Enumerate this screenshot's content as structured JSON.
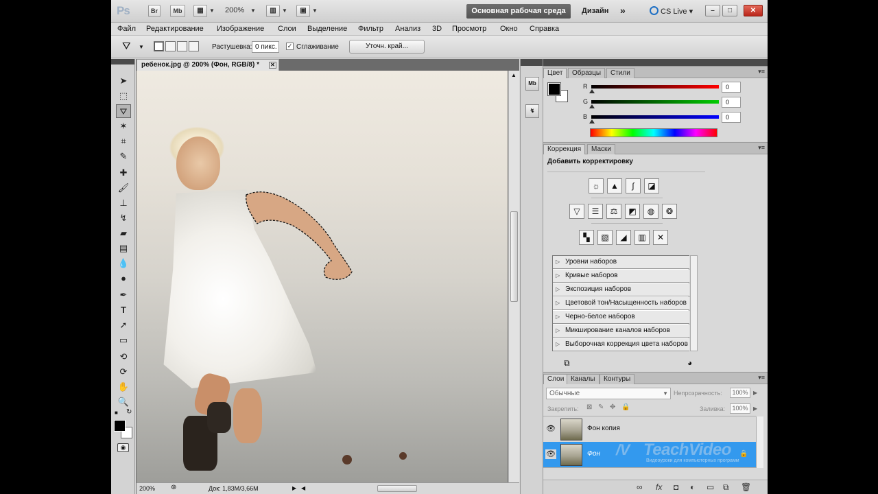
{
  "appbar": {
    "logo": "Ps",
    "br_label": "Br",
    "mb_label": "Mb",
    "zoom": "200%",
    "workspace": "Основная рабочая среда",
    "design": "Дизайн",
    "more": "»",
    "cslive": "CS Live"
  },
  "menu": [
    "Файл",
    "Редактирование",
    "Изображение",
    "Слои",
    "Выделение",
    "Фильтр",
    "Анализ",
    "3D",
    "Просмотр",
    "Окно",
    "Справка"
  ],
  "options": {
    "feather_label": "Растушевка:",
    "feather_value": "0 пикс.",
    "antialias_label": "Сглаживание",
    "antialias_checked": true,
    "refine_edge": "Уточн. край..."
  },
  "document": {
    "tab_title": "ребенок.jpg @ 200% (Фон, RGB/8) *",
    "status_zoom": "200%",
    "status_doc": "Док: 1,83М/3,66М"
  },
  "color_panel": {
    "tabs": [
      "Цвет",
      "Образцы",
      "Стили"
    ],
    "channels": [
      {
        "label": "R",
        "value": "0",
        "color": "#e00000"
      },
      {
        "label": "G",
        "value": "0",
        "color": "#00b000"
      },
      {
        "label": "B",
        "value": "0",
        "color": "#0000e0"
      }
    ]
  },
  "adjustments_panel": {
    "tabs": [
      "Коррекция",
      "Маски"
    ],
    "title": "Добавить корректировку",
    "presets": [
      "Уровни наборов",
      "Кривые наборов",
      "Экспозиция наборов",
      "Цветовой тон/Насыщенность наборов",
      "Черно-белое наборов",
      "Микширование каналов наборов",
      "Выборочная коррекция цвета наборов"
    ]
  },
  "layers_panel": {
    "tabs": [
      "Слои",
      "Каналы",
      "Контуры"
    ],
    "blend_mode": "Обычные",
    "opacity_label": "Непрозрачность:",
    "opacity": "100%",
    "lock_label": "Закрепить:",
    "fill_label": "Заливка:",
    "fill": "100%",
    "layers": [
      {
        "name": "Фон копия",
        "selected": false,
        "locked": false
      },
      {
        "name": "Фон",
        "selected": true,
        "locked": true
      }
    ]
  },
  "watermark": {
    "brand": "TeachVideo",
    "tagline": "Видеоуроки для компьютерных программ"
  },
  "colors": {
    "selected_layer": "#3399ee",
    "workspace_button": "#5e5e5e"
  }
}
